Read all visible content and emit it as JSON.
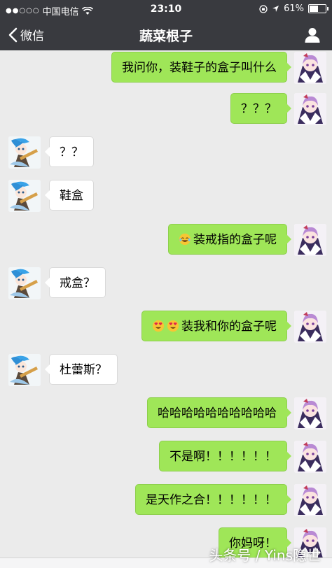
{
  "status_bar": {
    "signal": "●●○○○",
    "carrier": "中国电信",
    "time": "23:10",
    "battery_text": "61%",
    "battery_level": 0.61
  },
  "nav": {
    "back_label": "微信",
    "title": "蔬菜根子"
  },
  "messages": [
    {
      "side": "out",
      "text": "我问你，装鞋子的盒子叫什么"
    },
    {
      "side": "out",
      "text": "？？？"
    },
    {
      "side": "in",
      "text": "？？"
    },
    {
      "side": "in",
      "text": "鞋盒"
    },
    {
      "side": "out",
      "text": "装戒指的盒子呢",
      "emoji": [
        "joy"
      ]
    },
    {
      "side": "in",
      "text": "戒盒？"
    },
    {
      "side": "out",
      "text": "装我和你的盒子呢",
      "emoji": [
        "heart-eyes",
        "heart-eyes"
      ]
    },
    {
      "side": "in",
      "text": "杜蕾斯？"
    },
    {
      "side": "out",
      "text": "哈哈哈哈哈哈哈哈哈哈"
    },
    {
      "side": "out",
      "text": "不是啊！！！！！！"
    },
    {
      "side": "out",
      "text": "是天作之合！！！！！！"
    },
    {
      "side": "out",
      "text": "你妈呀！"
    }
  ],
  "watermark": "头条号 / Yins隐世",
  "colors": {
    "bar": "#393a3f",
    "chat_bg": "#ebebeb",
    "bubble_out": "#9fe658",
    "bubble_in": "#ffffff"
  },
  "icons": {
    "back": "chevron-left-icon",
    "profile": "person-icon",
    "wifi": "wifi-icon",
    "location": "location-arrow-icon"
  }
}
